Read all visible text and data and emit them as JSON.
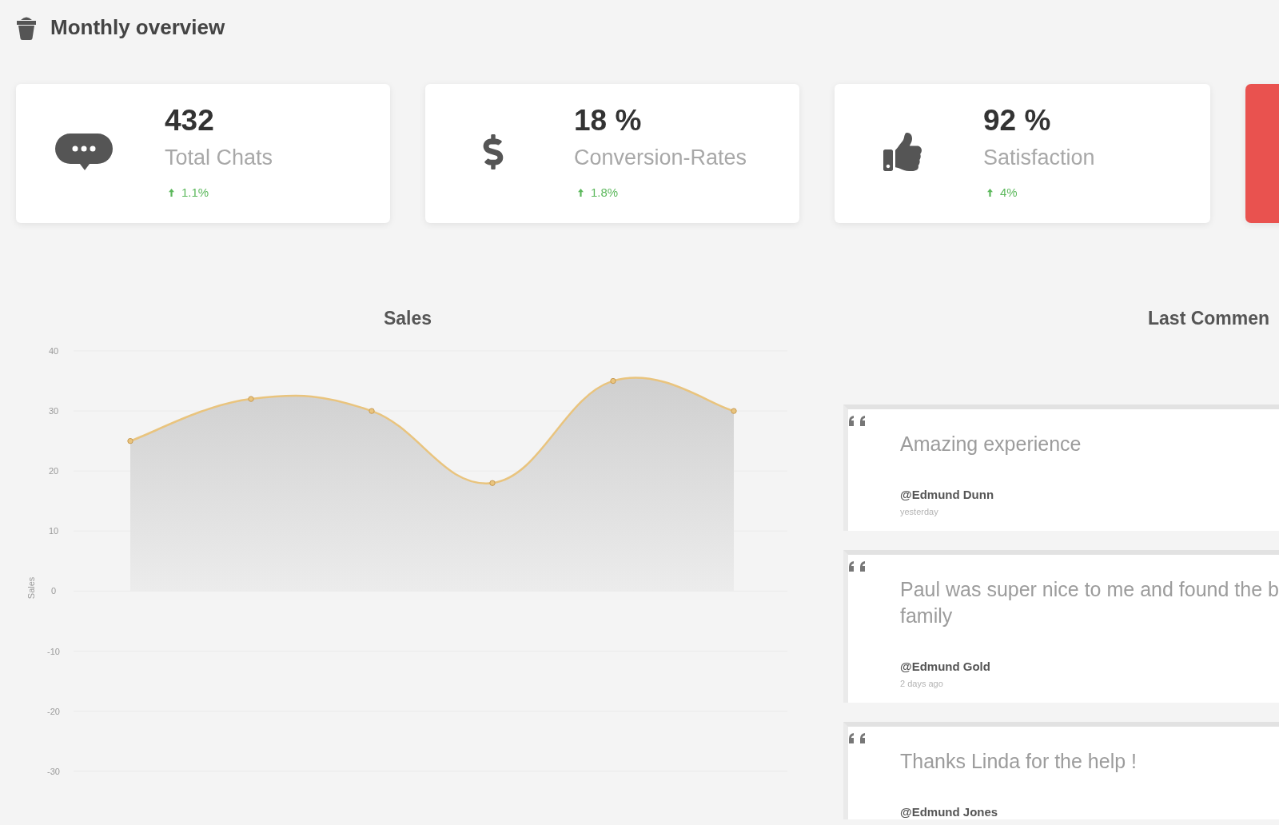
{
  "header": {
    "title": "Monthly overview"
  },
  "stat_cards": [
    {
      "value": "432",
      "label": "Total Chats",
      "change": "1.1%",
      "rising": true,
      "color": "#ffffff"
    },
    {
      "value": "18 %",
      "label": "Conversion-Rates",
      "change": "1.8%",
      "rising": true,
      "color": "#ffffff"
    },
    {
      "value": "92 %",
      "label": "Satisfaction",
      "change": "4%",
      "rising": true,
      "color": "#ffffff"
    },
    {
      "color": "#e9524f"
    }
  ],
  "sales": {
    "chart_data": {
      "type": "area",
      "title": "Sales",
      "ylabel": "Sales",
      "categories": [
        null,
        null,
        null,
        null,
        null,
        null
      ],
      "values": [
        25,
        32,
        30,
        18,
        35,
        30
      ],
      "color": "#e9c47e",
      "ylim": [
        -30,
        40
      ],
      "yticks": [
        40,
        30,
        20,
        10,
        0,
        -10,
        -20,
        -30
      ],
      "tick_labels": "y",
      "grid": true,
      "marker": "circle"
    }
  },
  "comments": {
    "title": "Last Commen",
    "items": [
      {
        "text_lines": [
          "Amazing experience"
        ],
        "author": "@Edmund Dunn",
        "date": "yesterday"
      },
      {
        "text_lines": [
          "Paul was super nice to me and found the b",
          "family"
        ],
        "author": "@Edmund Gold",
        "date": "2 days ago"
      },
      {
        "text_lines": [
          "Thanks Linda for the help !"
        ],
        "author": "@Edmund Jones"
      }
    ]
  }
}
